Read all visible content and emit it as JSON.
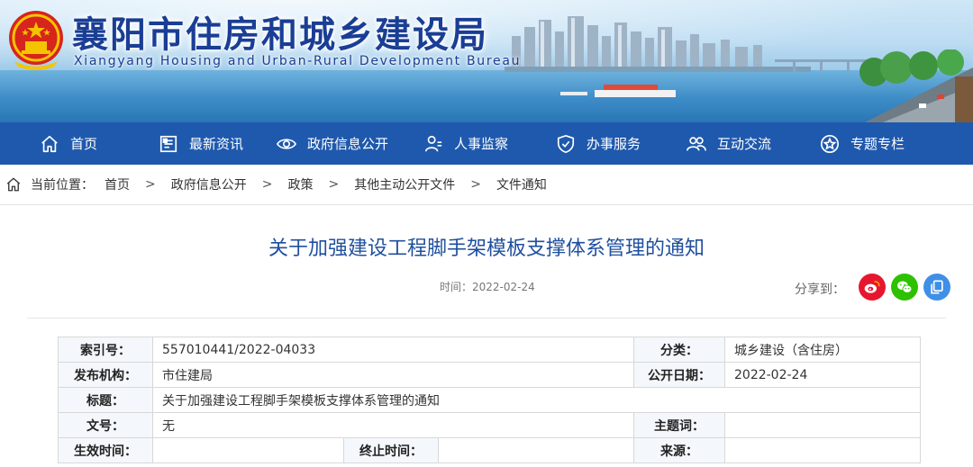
{
  "header": {
    "site_title": "襄阳市住房和城乡建设局",
    "site_subtitle": "Xiangyang Housing and Urban-Rural Development Bureau",
    "emblem_icon": "national-emblem-icon"
  },
  "nav": {
    "items": [
      {
        "label": "首页",
        "icon": "home-icon"
      },
      {
        "label": "最新资讯",
        "icon": "news-icon"
      },
      {
        "label": "政府信息公开",
        "icon": "eye-icon"
      },
      {
        "label": "人事监察",
        "icon": "person-icon"
      },
      {
        "label": "办事服务",
        "icon": "shield-icon"
      },
      {
        "label": "互动交流",
        "icon": "people-icon"
      },
      {
        "label": "专题专栏",
        "icon": "star-icon"
      }
    ],
    "background": "#1f59ad"
  },
  "breadcrumb": {
    "prefix": "当前位置：",
    "items": [
      "首页",
      "政府信息公开",
      "政策",
      "其他主动公开文件",
      "文件通知"
    ],
    "separator": ">"
  },
  "article": {
    "title": "关于加强建设工程脚手架模板支撑体系管理的通知",
    "time": "时间：2022-02-24",
    "title_color": "#1f4f9e"
  },
  "share": {
    "label": "分享到：",
    "buttons": [
      {
        "icon": "weibo-icon",
        "color": "#e6162d"
      },
      {
        "icon": "wechat-icon",
        "color": "#2dc100"
      },
      {
        "icon": "copy-icon",
        "color": "#3f8fe6"
      }
    ]
  },
  "info": {
    "index_label": "索引号：",
    "index_value": "557010441/2022-04033",
    "category_label": "分类：",
    "category_value": "城乡建设（含住房）",
    "publisher_label": "发布机构：",
    "publisher_value": "市住建局",
    "public_date_label": "公开日期：",
    "public_date_value": "2022-02-24",
    "title_label": "标题：",
    "title_value": "关于加强建设工程脚手架模板支撑体系管理的通知",
    "doc_no_label": "文号：",
    "doc_no_value": "无",
    "keywords_label": "主题词：",
    "keywords_value": "",
    "effective_label": "生效时间：",
    "effective_value": "",
    "end_label": "终止时间：",
    "end_value": "",
    "source_label": "来源：",
    "source_value": ""
  }
}
